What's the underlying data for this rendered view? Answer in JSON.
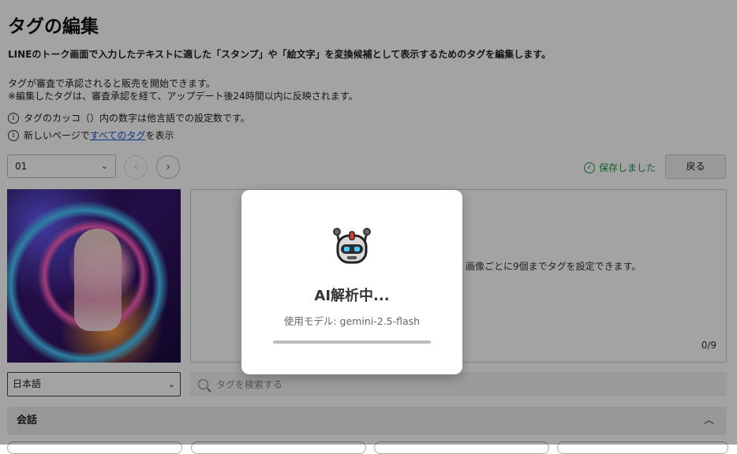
{
  "page": {
    "title": "タグの編集",
    "description": "LINEのトーク画面で入力したテキストに適した「スタンプ」や「絵文字」を変換候補として表示するためのタグを編集します。",
    "notes": [
      "タグが審査で承認されると販売を開始できます。",
      "※編集したタグは、審査承認を経て、アップデート後24時間以内に反映されます。"
    ],
    "info_line_1": "タグのカッコ（）内の数字は他言語での設定数です。",
    "info_line_2_prefix": "新しいページで",
    "info_line_2_link": "すべてのタグ",
    "info_line_2_suffix": "を表示"
  },
  "toolbar": {
    "sticker_select_value": "01",
    "saved_text": "保存しました",
    "back_label": "戻る"
  },
  "tag_panel": {
    "hint": "画像ごとに9個までタグを設定できます。",
    "count": "0/9"
  },
  "language_select_value": "日本語",
  "search": {
    "placeholder": "タグを検索する"
  },
  "category": {
    "label": "会話"
  },
  "modal": {
    "title": "AI解析中...",
    "subtitle": "使用モデル: gemini-2.5-flash",
    "progress": 1.0
  },
  "colors": {
    "accent_green": "#1d9a46",
    "link_blue": "#1a55d6",
    "overlay": "rgba(0,0,0,0.36)"
  },
  "icons": [
    "info-icon",
    "chevron-down-icon",
    "chevron-left-icon",
    "chevron-right-icon",
    "check-circle-icon",
    "search-icon",
    "chevron-up-icon",
    "robot-icon"
  ]
}
